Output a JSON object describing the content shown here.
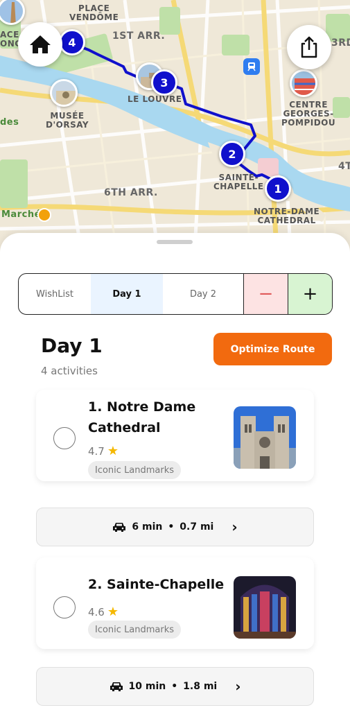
{
  "map": {
    "labels": {
      "place_vendome": "PLACE\nVENDÔME",
      "place_de_concorde": "ACE DE\nONCO",
      "first_arr": "1ST ARR.",
      "third_arr": "3RD",
      "fourth_arr": "4T",
      "le_louvre": "LE LOUVRE",
      "musee_orsay": "MUSÉE\nD'ORSAY",
      "centre_pompidou": "CENTRE\nGEORGES-\nPOMPIDOU",
      "sixth_arr": "6TH ARR.",
      "sainte_chapelle": "SAINTE-\nCHAPELLE",
      "notre_dame": "NOTRE-DAME\nCATHEDRAL",
      "marche": "Marché",
      "des": "des"
    },
    "markers": [
      "1",
      "2",
      "3",
      "4"
    ],
    "route_color": "#1010cc",
    "icons": {
      "home": "home-icon",
      "share": "share-icon",
      "metro": "metro-icon"
    }
  },
  "tabs": {
    "wishlist": "WishList",
    "day1": "Day 1",
    "day2": "Day 2",
    "minus": "−",
    "plus": "+"
  },
  "day": {
    "title": "Day 1",
    "subtitle": "4 activities",
    "optimize_label": "Optimize Route"
  },
  "activities": [
    {
      "name": "1. Notre Dame Cathedral",
      "rating": "4.7",
      "tag": "Iconic Landmarks"
    },
    {
      "name": "2. Sainte-Chapelle",
      "rating": "4.6",
      "tag": "Iconic Landmarks"
    }
  ],
  "travel": [
    {
      "time": "6 min",
      "distance": "0.7 mi"
    },
    {
      "time": "10 min",
      "distance": "1.8 mi"
    }
  ],
  "colors": {
    "accent_orange": "#f26a0f",
    "tab_selected_bg": "#eaf4ff",
    "minus_bg": "#fde3e3",
    "plus_bg": "#d8f4d2",
    "star": "#f5b800"
  }
}
